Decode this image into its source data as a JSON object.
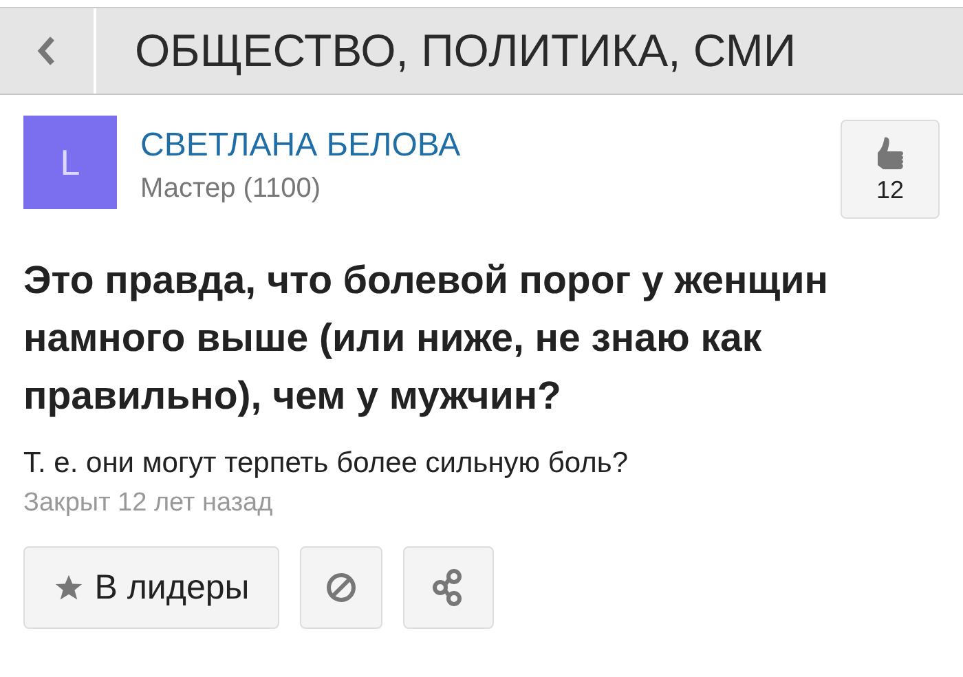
{
  "header": {
    "title": "ОБЩЕСТВО, ПОЛИТИКА, СМИ"
  },
  "author": {
    "initial": "L",
    "name": "СВЕТЛАНА БЕЛОВА",
    "rank": "Мастер (1100)"
  },
  "likes": {
    "count": "12"
  },
  "question": {
    "title": "Это правда, что болевой порог у женщин намного выше (или ниже, не знаю как правильно), чем у мужчин?",
    "body": "Т. е. они могут терпеть более сильную боль?",
    "status": "Закрыт 12 лет назад"
  },
  "actions": {
    "leader_label": "В лидеры"
  }
}
